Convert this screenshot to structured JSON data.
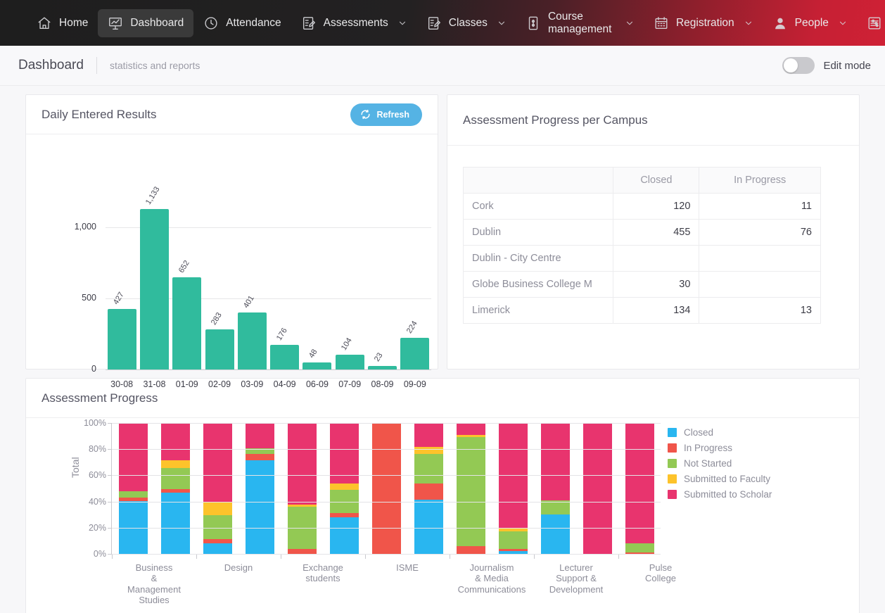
{
  "nav": {
    "items": [
      {
        "label": "Home",
        "icon": "home-icon",
        "active": false,
        "caret": false
      },
      {
        "label": "Dashboard",
        "icon": "dashboard-icon",
        "active": true,
        "caret": false
      },
      {
        "label": "Attendance",
        "icon": "clock-icon",
        "active": false,
        "caret": false
      },
      {
        "label": "Assessments",
        "icon": "assessments-icon",
        "active": false,
        "caret": true
      },
      {
        "label": "Classes",
        "icon": "classes-icon",
        "active": false,
        "caret": true
      },
      {
        "label": "Course management",
        "icon": "course-management-icon",
        "active": false,
        "caret": true
      },
      {
        "label": "Registration",
        "icon": "calendar-icon",
        "active": false,
        "caret": true
      },
      {
        "label": "People",
        "icon": "people-icon",
        "active": false,
        "caret": true
      },
      {
        "label": "Admin",
        "icon": "admin-icon",
        "active": false,
        "caret": false
      }
    ]
  },
  "breadcrumb": {
    "title": "Dashboard",
    "subtitle": "statistics and reports",
    "edit_mode_label": "Edit mode",
    "edit_mode_on": false
  },
  "daily_card": {
    "title": "Daily Entered Results",
    "refresh_label": "Refresh"
  },
  "campus_card": {
    "title": "Assessment Progress per Campus",
    "columns": [
      "",
      "Closed",
      "In Progress"
    ],
    "rows": [
      {
        "name": "Cork",
        "closed": "120",
        "in_progress": "11"
      },
      {
        "name": "Dublin",
        "closed": "455",
        "in_progress": "76"
      },
      {
        "name": "Dublin - City Centre",
        "closed": "",
        "in_progress": ""
      },
      {
        "name": "Globe Business College M",
        "closed": "30",
        "in_progress": ""
      },
      {
        "name": "Limerick",
        "closed": "134",
        "in_progress": "13"
      }
    ]
  },
  "progress_card": {
    "title": "Assessment Progress"
  },
  "chart_data": [
    {
      "type": "bar",
      "title": "Daily Entered Results",
      "categories": [
        "30-08",
        "31-08",
        "01-09",
        "02-09",
        "03-09",
        "04-09",
        "06-09",
        "07-09",
        "08-09",
        "09-09"
      ],
      "values": [
        427,
        1133,
        652,
        283,
        401,
        176,
        48,
        104,
        23,
        224
      ],
      "value_labels": [
        "427",
        "1,133",
        "652",
        "283",
        "401",
        "176",
        "48",
        "104",
        "23",
        "224"
      ],
      "ytick_labels": [
        "0",
        "500",
        "1,000"
      ],
      "yticks": [
        0,
        500,
        1000
      ],
      "ylim": [
        0,
        1250
      ],
      "xlabel": "",
      "ylabel": "",
      "grid": true,
      "series_color": "#30bb9d",
      "legend": "none"
    },
    {
      "type": "bar",
      "subtype": "stacked-percent",
      "title": "Assessment Progress",
      "ylabel": "Total",
      "xlabel": "",
      "ytick_labels": [
        "0%",
        "20%",
        "40%",
        "60%",
        "80%",
        "100%"
      ],
      "yticks": [
        0,
        20,
        40,
        60,
        80,
        100
      ],
      "ylim": [
        0,
        100
      ],
      "grid": true,
      "legend": "right",
      "categories": [
        "Business & Management Studies",
        "",
        "Design",
        "",
        "Exchange students",
        "",
        "ISME",
        "",
        "Journalism & Media Communications",
        "",
        "Lecturer Support & Development",
        "",
        "Pulse College"
      ],
      "visible_xlabels": [
        "Business\n&\nManagement\nStudies",
        "Design",
        "Exchange\nstudents",
        "ISME",
        "Journalism\n& Media\nCommunications",
        "Lecturer\nSupport &\nDevelopment",
        "Pulse\nCollege"
      ],
      "series": [
        {
          "name": "Closed",
          "color": "#29b6f0",
          "values": [
            40.5,
            46.5,
            8,
            71.5,
            0,
            28,
            0,
            41.5,
            0,
            2,
            30,
            0,
            0
          ]
        },
        {
          "name": "In Progress",
          "color": "#f0554a",
          "values": [
            2.5,
            3,
            3.5,
            5,
            4,
            3,
            100,
            12,
            6,
            2,
            0,
            0,
            1
          ]
        },
        {
          "name": "Not Started",
          "color": "#93c954",
          "values": [
            5,
            16,
            18,
            4,
            32,
            18,
            0,
            23,
            83,
            13,
            11,
            0,
            7
          ]
        },
        {
          "name": "Submitted to Faculty",
          "color": "#fdc32b",
          "values": [
            0,
            6,
            10.5,
            0,
            1.5,
            5,
            0,
            5,
            2,
            3,
            0,
            0,
            0
          ]
        },
        {
          "name": "Submitted to Scholar",
          "color": "#e8346e",
          "values": [
            52,
            28.5,
            60,
            19.5,
            62.5,
            46,
            0,
            18.5,
            9,
            80,
            59,
            100,
            92
          ]
        }
      ],
      "legend_entries": [
        {
          "label": "Closed",
          "color": "#29b6f0"
        },
        {
          "label": "In Progress",
          "color": "#f0554a"
        },
        {
          "label": "Not Started",
          "color": "#93c954"
        },
        {
          "label": "Submitted to Faculty",
          "color": "#fdc32b"
        },
        {
          "label": "Submitted to Scholar",
          "color": "#e8346e"
        }
      ]
    }
  ]
}
